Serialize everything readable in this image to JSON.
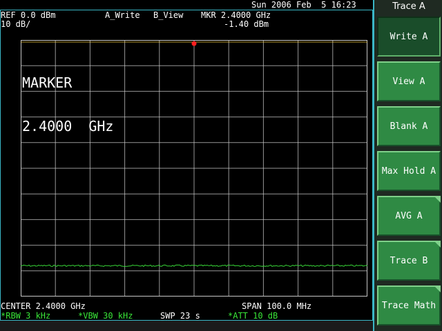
{
  "header": {
    "datetime": "Sun 2006 Feb  5 16:23",
    "ref_level": "REF 0.0 dBm",
    "scale": "10 dB/",
    "trace_a_mode": "A_Write",
    "trace_b_mode": "B_View",
    "marker_freq": "MKR 2.4000 GHz",
    "marker_amp": "-1.40 dBm"
  },
  "marker_readout": {
    "label": "MARKER",
    "freq": "2.4000  GHz"
  },
  "footer": {
    "center": "CENTER 2.4000 GHz",
    "span": "SPAN 100.0 MHz",
    "rbw": "*RBW 3 kHz",
    "vbw": "*VBW 30 kHz",
    "sweep": "SWP 23 s",
    "att": "*ATT 10 dB"
  },
  "panel": {
    "title": "Trace A",
    "softkeys": [
      {
        "label": "Write A",
        "active": true,
        "more": false
      },
      {
        "label": "View A",
        "active": false,
        "more": false
      },
      {
        "label": "Blank A",
        "active": false,
        "more": false
      },
      {
        "label": "Max Hold A",
        "active": false,
        "more": false
      },
      {
        "label": "AVG A",
        "active": false,
        "more": true
      },
      {
        "label": "Trace B",
        "active": false,
        "more": true
      },
      {
        "label": "Trace Math",
        "active": false,
        "more": true
      }
    ]
  },
  "colors": {
    "grid": "#c8c8c8",
    "trace": "#38d838",
    "marker": "#ff2020",
    "softkey": "#2f8a44",
    "panel_border": "#3ab7c7"
  },
  "chart_data": {
    "type": "line",
    "xlabel": "",
    "ylabel": "",
    "x_center_ghz": 2.4,
    "x_span_mhz": 100.0,
    "y_ref_dbm": 0.0,
    "y_scale_db_per_div": 10,
    "divisions": {
      "x": 10,
      "y": 10
    },
    "grid": true,
    "series": [
      {
        "values_dbm": [
          -88,
          -88,
          -88,
          -88,
          -88,
          -88,
          -88,
          -88,
          -88,
          -88,
          -88
        ]
      }
    ],
    "marker": {
      "freq_ghz": 2.4,
      "amp_dbm": -1.4
    }
  }
}
